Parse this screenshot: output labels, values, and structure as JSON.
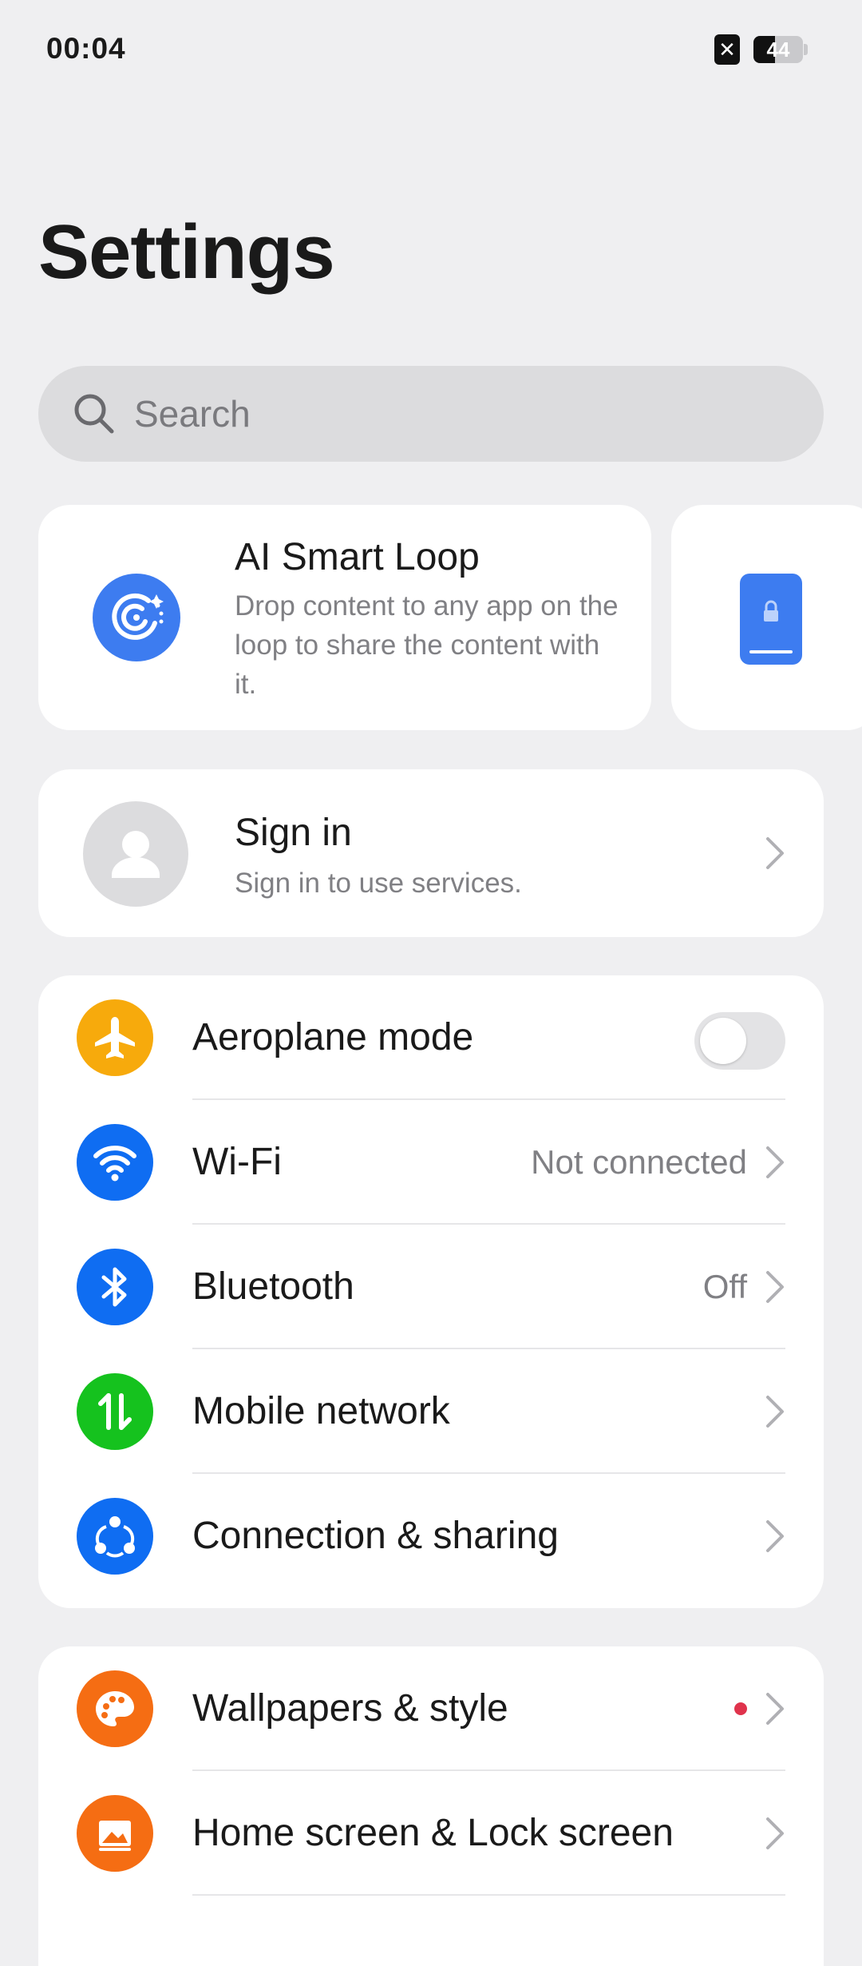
{
  "status_bar": {
    "time": "00:04",
    "battery_level": "44",
    "battery_fraction": 0.44
  },
  "header": {
    "title": "Settings"
  },
  "search": {
    "placeholder": "Search",
    "value": ""
  },
  "promo_cards": [
    {
      "title": "AI Smart Loop",
      "description": "Drop content to any app on the loop to share the content with it.",
      "icon": "smart-loop-icon",
      "color": "#3d7cf0"
    },
    {
      "icon": "lock-phone-icon",
      "color": "#3d7cf0"
    }
  ],
  "account": {
    "title": "Sign in",
    "subtitle": "Sign in to use services.",
    "icon": "avatar-icon"
  },
  "connectivity": [
    {
      "label": "Aeroplane mode",
      "icon": "airplane-icon",
      "color": "#f7aa0c",
      "toggle": false
    },
    {
      "label": "Wi-Fi",
      "icon": "wifi-icon",
      "color": "#0f6df2",
      "value": "Not connected"
    },
    {
      "label": "Bluetooth",
      "icon": "bluetooth-icon",
      "color": "#0f6df2",
      "value": "Off"
    },
    {
      "label": "Mobile network",
      "icon": "mobile-data-icon",
      "color": "#15c21e"
    },
    {
      "label": "Connection & sharing",
      "icon": "share-icon",
      "color": "#0f6df2"
    }
  ],
  "personalization": [
    {
      "label": "Wallpapers & style",
      "icon": "palette-icon",
      "color": "#f56d13",
      "badge": "#e0334c"
    },
    {
      "label": "Home screen & Lock screen",
      "icon": "home-screen-icon",
      "color": "#f56d13"
    }
  ]
}
